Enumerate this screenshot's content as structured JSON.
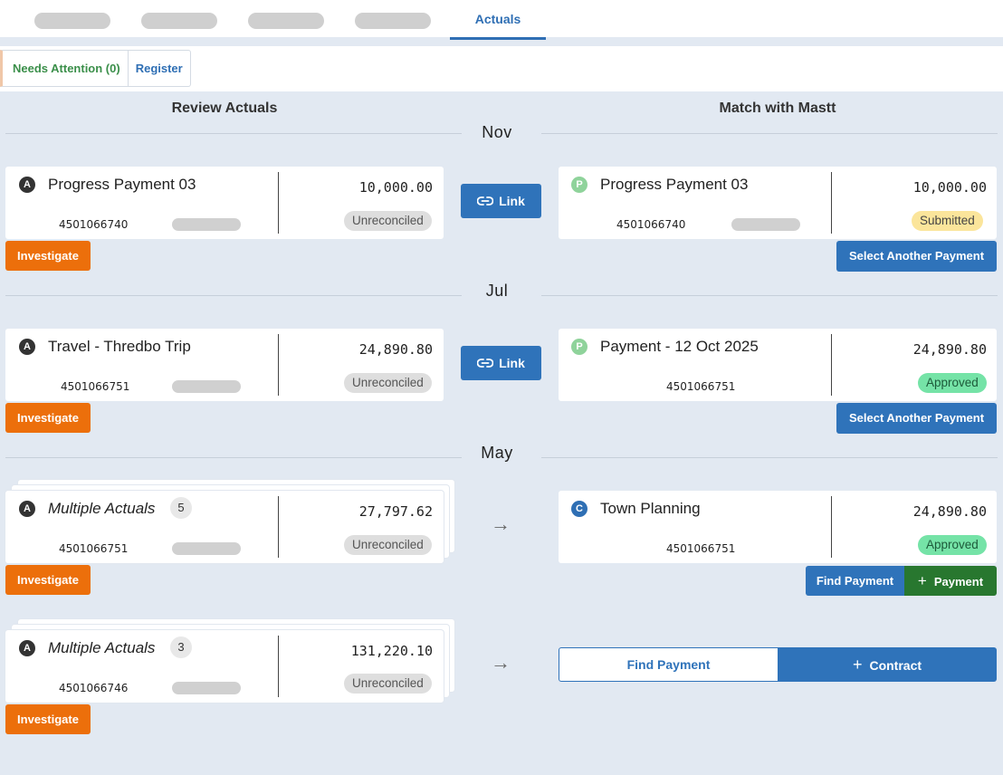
{
  "tabs": {
    "active_label": "Actuals"
  },
  "filters": {
    "needs_attention": "Needs Attention (0)",
    "register": "Register"
  },
  "columns": {
    "left": "Review Actuals",
    "right": "Match with Mastt"
  },
  "months": [
    "Nov",
    "Jul",
    "May"
  ],
  "rows": [
    {
      "left": {
        "avatar": "A",
        "title": "Progress Payment 03",
        "ref": "4501066740",
        "amount": "10,000.00",
        "status": "Unreconciled",
        "action": "Investigate"
      },
      "middle": {
        "link_label": "Link"
      },
      "right": {
        "avatar": "P",
        "title": "Progress Payment 03",
        "ref": "4501066740",
        "amount": "10,000.00",
        "status": "Submitted",
        "action": "Select Another Payment"
      }
    },
    {
      "left": {
        "avatar": "A",
        "title": "Travel - Thredbo Trip",
        "ref": "4501066751",
        "amount": "24,890.80",
        "status": "Unreconciled",
        "action": "Investigate"
      },
      "middle": {
        "link_label": "Link"
      },
      "right": {
        "avatar": "P",
        "title": "Payment - 12 Oct 2025",
        "ref": "4501066751",
        "amount": "24,890.80",
        "status": "Approved",
        "action": "Select Another Payment"
      }
    },
    {
      "left": {
        "avatar": "A",
        "title": "Multiple Actuals",
        "count": "5",
        "ref": "4501066751",
        "amount": "27,797.62",
        "status": "Unreconciled",
        "action": "Investigate"
      },
      "middle": {
        "arrow": "→"
      },
      "right": {
        "avatar": "C",
        "title": "Town Planning",
        "ref": "4501066751",
        "amount": "24,890.80",
        "status": "Approved",
        "find_label": "Find Payment",
        "add_label": "Payment"
      }
    },
    {
      "left": {
        "avatar": "A",
        "title": "Multiple Actuals",
        "count": "3",
        "ref": "4501066746",
        "amount": "131,220.10",
        "status": "Unreconciled",
        "action": "Investigate"
      },
      "middle": {
        "arrow": "→"
      },
      "right": {
        "find_label": "Find Payment",
        "add_label": "Contract"
      }
    }
  ],
  "icons": {
    "link": "link-icon",
    "plus": "plus-icon",
    "arrow": "arrow-right-icon"
  },
  "colors": {
    "primary": "#2f73ba",
    "investigate": "#ec6f0b",
    "add_payment": "#28772f",
    "submitted": "#fbe59b",
    "approved": "#75e3a7",
    "background": "#e2e9f2"
  }
}
